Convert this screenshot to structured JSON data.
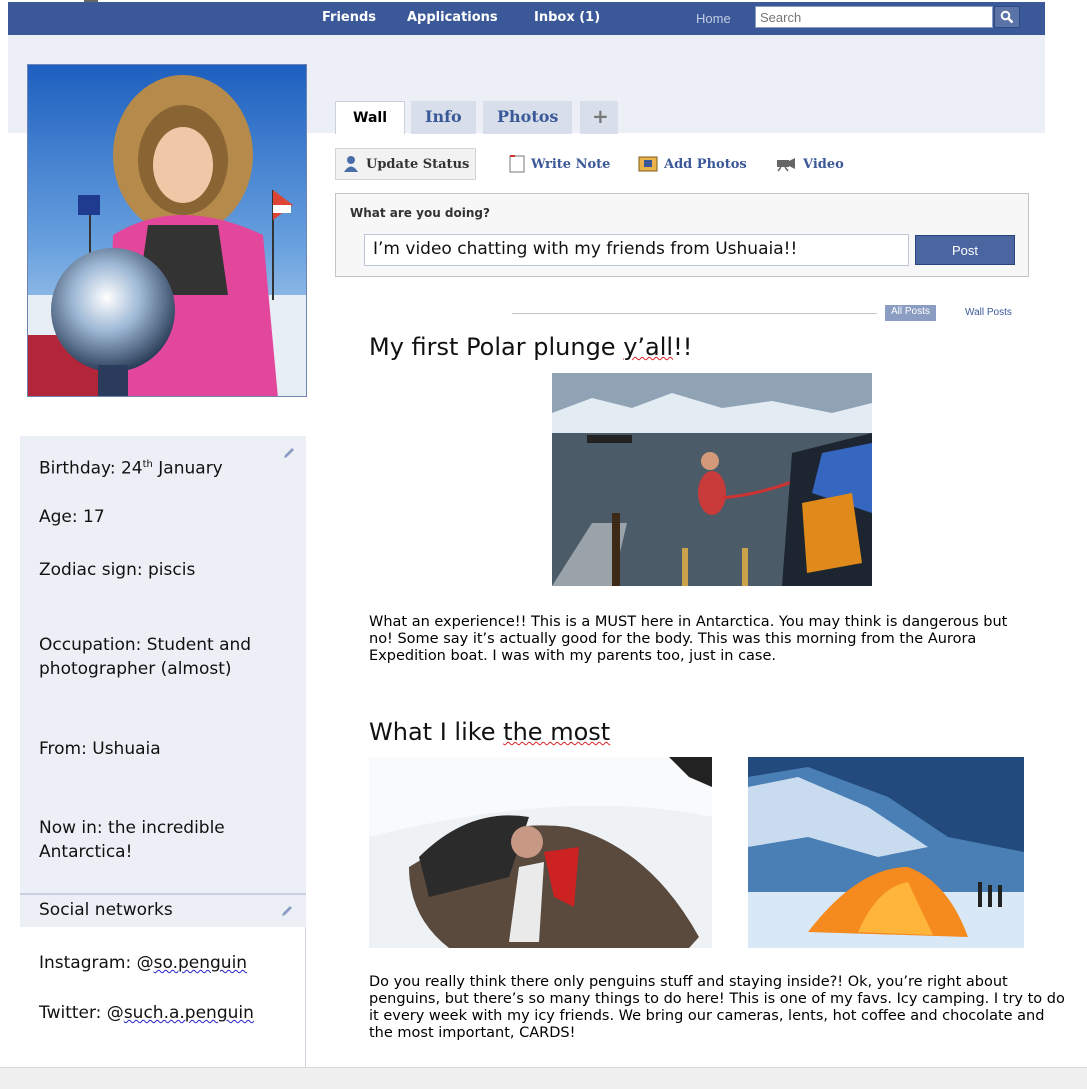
{
  "nav": {
    "friends": "Friends",
    "applications": "Applications",
    "inbox": "Inbox (1)",
    "home": "Home",
    "search_placeholder": "Search"
  },
  "tabs": [
    {
      "label": "Wall",
      "active": true
    },
    {
      "label": "Info",
      "active": false
    },
    {
      "label": "Photos",
      "active": false
    },
    {
      "label": "+",
      "active": false
    }
  ],
  "publisher": {
    "update_status": "Update Status",
    "write_note": "Write Note",
    "add_photos": "Add Photos",
    "video": "Video",
    "question": "What are you doing?",
    "status_value": "I’m video chatting with my friends from Ushuaia!!",
    "post_label": "Post"
  },
  "filters": {
    "all_posts": "All Posts",
    "wall_posts": "Wall Posts"
  },
  "posts": [
    {
      "title_start": "My first Polar plunge ",
      "title_squiggle": "y’all",
      "title_end": "!!",
      "body": "What an experience!! This is a MUST here in Antarctica. You may think is dangerous but no! Some say it’s actually good for the body. This was this morning from the Aurora Expedition boat. I was with my parents too, just in case."
    },
    {
      "title_start": "What I like ",
      "title_squiggle": "the most",
      "body": "Do you really think there only penguins stuff and staying inside?! Ok, you’re right about penguins, but there’s so many things to do here! This is one of my favs. Icy camping. I try to do it every week with my icy friends. We bring our cameras, lents, hot coffee and chocolate and the most important, CARDS!"
    }
  ],
  "info": {
    "birthday_label": "Birthday: 24",
    "birthday_sup": "th",
    "birthday_month": " January",
    "age": "Age: 17",
    "zodiac": "Zodiac sign: piscis",
    "occupation": "Occupation: Student and photographer (almost)",
    "from": "From: Ushuaia",
    "now_in": "Now in: the incredible Antarctica!",
    "social_header": "Social networks",
    "instagram_label": "Instagram: @",
    "instagram_handle": "so.penguin",
    "twitter_label": "Twitter: @",
    "twitter_handle": "such.a.penguin"
  },
  "colors": {
    "brand": "#3b5998",
    "panel": "#eceff5"
  },
  "icons": [
    "search-icon",
    "person-icon",
    "note-icon",
    "photo-icon",
    "video-camera-icon",
    "pencil-icon"
  ]
}
